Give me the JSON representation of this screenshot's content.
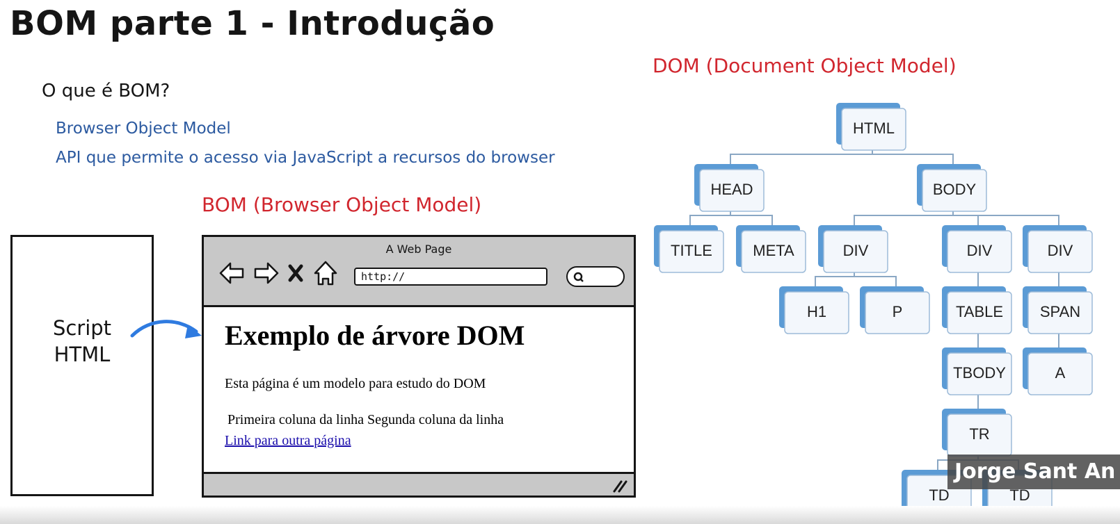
{
  "slide": {
    "title": "BOM parte 1 - Introdução",
    "question": "O que é BOM?",
    "points": [
      "Browser Object Model",
      "API que permite o acesso via JavaScript a recursos do browser"
    ],
    "bom_heading": "BOM (Browser Object Model)",
    "dom_heading": "DOM (Document Object Model)",
    "script_label_line1": "Script",
    "script_label_line2": "HTML"
  },
  "browser": {
    "window_title": "A Web Page",
    "address": "http://",
    "page_heading": "Exemplo de árvore DOM",
    "page_paragraph": "Esta página é um modelo para estudo do DOM",
    "page_table_row": "Primeira coluna da linha Segunda coluna da linha",
    "page_link": "Link para outra página"
  },
  "dom_tree": {
    "nodes": [
      {
        "id": "html",
        "label": "HTML"
      },
      {
        "id": "head",
        "label": "HEAD"
      },
      {
        "id": "body",
        "label": "BODY"
      },
      {
        "id": "title",
        "label": "TITLE"
      },
      {
        "id": "meta",
        "label": "META"
      },
      {
        "id": "div1",
        "label": "DIV"
      },
      {
        "id": "div2",
        "label": "DIV"
      },
      {
        "id": "div3",
        "label": "DIV"
      },
      {
        "id": "h1",
        "label": "H1"
      },
      {
        "id": "p",
        "label": "P"
      },
      {
        "id": "table",
        "label": "TABLE"
      },
      {
        "id": "span",
        "label": "SPAN"
      },
      {
        "id": "tbody",
        "label": "TBODY"
      },
      {
        "id": "a",
        "label": "A"
      },
      {
        "id": "tr",
        "label": "TR"
      },
      {
        "id": "td1",
        "label": "TD"
      },
      {
        "id": "td2",
        "label": "TD"
      }
    ],
    "edges": [
      [
        "html",
        "head"
      ],
      [
        "html",
        "body"
      ],
      [
        "head",
        "title"
      ],
      [
        "head",
        "meta"
      ],
      [
        "body",
        "div1"
      ],
      [
        "body",
        "div2"
      ],
      [
        "body",
        "div3"
      ],
      [
        "div1",
        "h1"
      ],
      [
        "div1",
        "p"
      ],
      [
        "div2",
        "table"
      ],
      [
        "div3",
        "span"
      ],
      [
        "table",
        "tbody"
      ],
      [
        "span",
        "a"
      ],
      [
        "tbody",
        "tr"
      ],
      [
        "tr",
        "td1"
      ],
      [
        "tr",
        "td2"
      ]
    ],
    "colors": {
      "node_accent": "#5b9bd5",
      "node_fill": "#f3f7fc",
      "edge": "#8aa7c4"
    }
  },
  "overlay": {
    "presenter_name": "Jorge Sant An"
  },
  "colors": {
    "heading_red": "#d1262e",
    "text_blue": "#2c5aa0",
    "arrow_blue": "#2f7be0"
  },
  "icons": [
    "back-arrow-icon",
    "forward-arrow-icon",
    "close-icon",
    "home-icon",
    "search-icon",
    "resize-grip-icon",
    "curved-arrow-icon"
  ]
}
